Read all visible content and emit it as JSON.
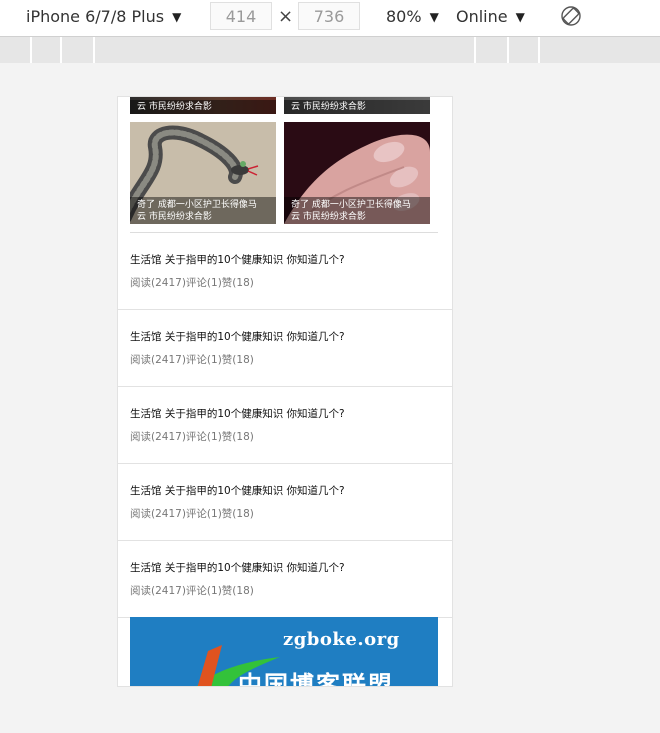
{
  "toolbar": {
    "device": "iPhone 6/7/8 Plus",
    "width": "414",
    "times": "×",
    "height": "736",
    "zoom": "80%",
    "network": "Online"
  },
  "images": {
    "top_left_caption": "云 市民纷纷求合影",
    "top_right_caption": "云 市民纷纷求合影",
    "card_left": {
      "line1": "奇了 成都一小区护卫长得像马",
      "line2": "云 市民纷纷求合影"
    },
    "card_right": {
      "line1": "奇了 成都一小区护卫长得像马",
      "line2": "云 市民纷纷求合影"
    }
  },
  "news": [
    {
      "title": "生活馆 关于指甲的10个健康知识 你知道几个?",
      "meta": "阅读(2417)评论(1)赞(18)"
    },
    {
      "title": "生活馆 关于指甲的10个健康知识 你知道几个?",
      "meta": "阅读(2417)评论(1)赞(18)"
    },
    {
      "title": "生活馆 关于指甲的10个健康知识 你知道几个?",
      "meta": "阅读(2417)评论(1)赞(18)"
    },
    {
      "title": "生活馆 关于指甲的10个健康知识 你知道几个?",
      "meta": "阅读(2417)评论(1)赞(18)"
    },
    {
      "title": "生活馆 关于指甲的10个健康知识 你知道几个?",
      "meta": "阅读(2417)评论(1)赞(18)"
    }
  ],
  "banner": {
    "url": "zgboke.org",
    "name": "中国博客联盟"
  }
}
